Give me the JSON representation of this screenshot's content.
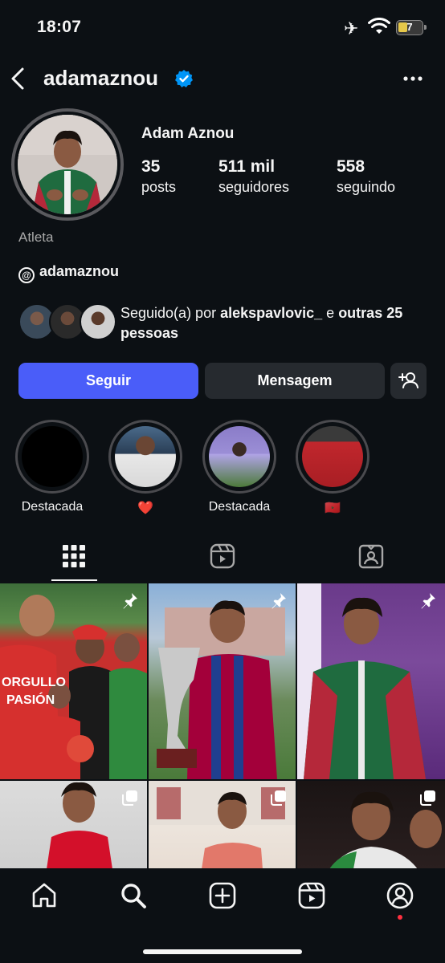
{
  "status_bar": {
    "time": "18:07",
    "battery": "7"
  },
  "header": {
    "username": "adamaznou"
  },
  "profile": {
    "full_name": "Adam Aznou",
    "stats": [
      {
        "value": "35",
        "label": "posts"
      },
      {
        "value": "511 mil",
        "label": "seguidores"
      },
      {
        "value": "558",
        "label": "seguindo"
      }
    ],
    "category": "Atleta",
    "threads_handle": "adamaznou",
    "followed_by_prefix": "Seguido(a) por ",
    "followed_by_user": "alekspavlovic_",
    "followed_by_mid": " e ",
    "followed_by_others": "outras 25 pessoas"
  },
  "buttons": {
    "follow": "Seguir",
    "message": "Mensagem"
  },
  "highlights": [
    {
      "label": "Destacada"
    },
    {
      "label": "❤️"
    },
    {
      "label": "Destacada"
    },
    {
      "label": "🇲🇦"
    }
  ],
  "colors": {
    "accent": "#4a5df9",
    "verified": "#0095f6",
    "background": "#0c1014",
    "button_secondary": "#262a2f"
  }
}
